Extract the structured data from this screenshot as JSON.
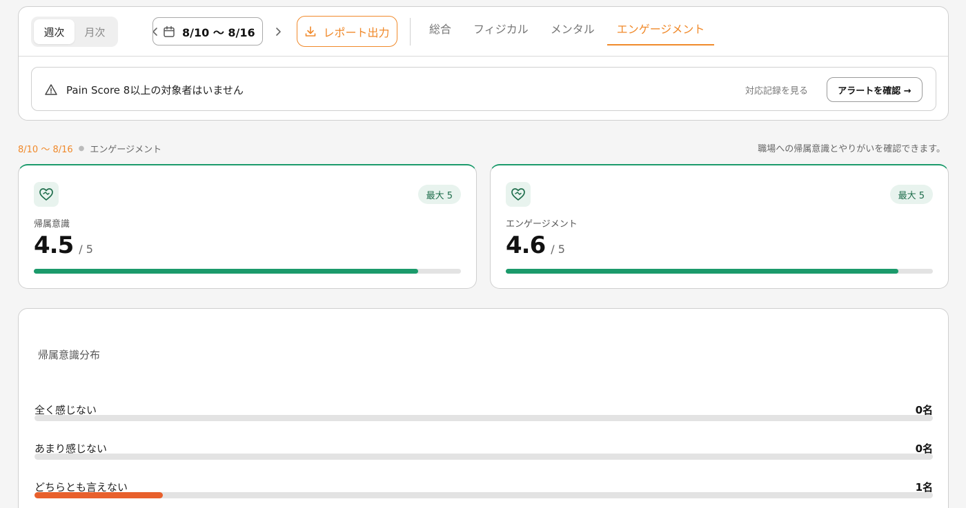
{
  "toolbar": {
    "period_options": [
      "週次",
      "月次"
    ],
    "active_period": "週次",
    "date_range": "8/10 〜 8/16",
    "export_label": "レポート出力",
    "tabs": [
      "総合",
      "フィジカル",
      "メンタル",
      "エンゲージメント"
    ],
    "active_tab": "エンゲージメント"
  },
  "alert": {
    "message": "Pain Score 8以上の対象者はいません",
    "history_link": "対応記録を見る",
    "confirm_label": "アラートを確認 →"
  },
  "section": {
    "range": "8/10 〜 8/16",
    "category": "エンゲージメント",
    "description": "職場への帰属意識とやりがいを確認できます。"
  },
  "metrics": [
    {
      "label": "帰属意識",
      "value": "4.5",
      "denominator": "/ 5",
      "max_badge": "最大 5",
      "level": 4.5,
      "max": 5
    },
    {
      "label": "エンゲージメント",
      "value": "4.6",
      "denominator": "/ 5",
      "max_badge": "最大 5",
      "level": 4.6,
      "max": 5
    }
  ],
  "distribution": {
    "title": "帰属意識分布",
    "rows": [
      {
        "label": "全く感じない",
        "count": "0名",
        "fraction": 0
      },
      {
        "label": "あまり感じない",
        "count": "0名",
        "fraction": 0
      },
      {
        "label": "どちらとも言えない",
        "count": "1名",
        "fraction": 0.143
      }
    ]
  },
  "colors": {
    "accent_orange": "#f0892a",
    "accent_green": "#1b9a6b",
    "bar_orange": "#e8602c"
  },
  "icons": [
    "chevron-left-icon",
    "chevron-right-icon",
    "calendar-icon",
    "download-icon",
    "warning-icon",
    "heart-handshake-icon"
  ]
}
